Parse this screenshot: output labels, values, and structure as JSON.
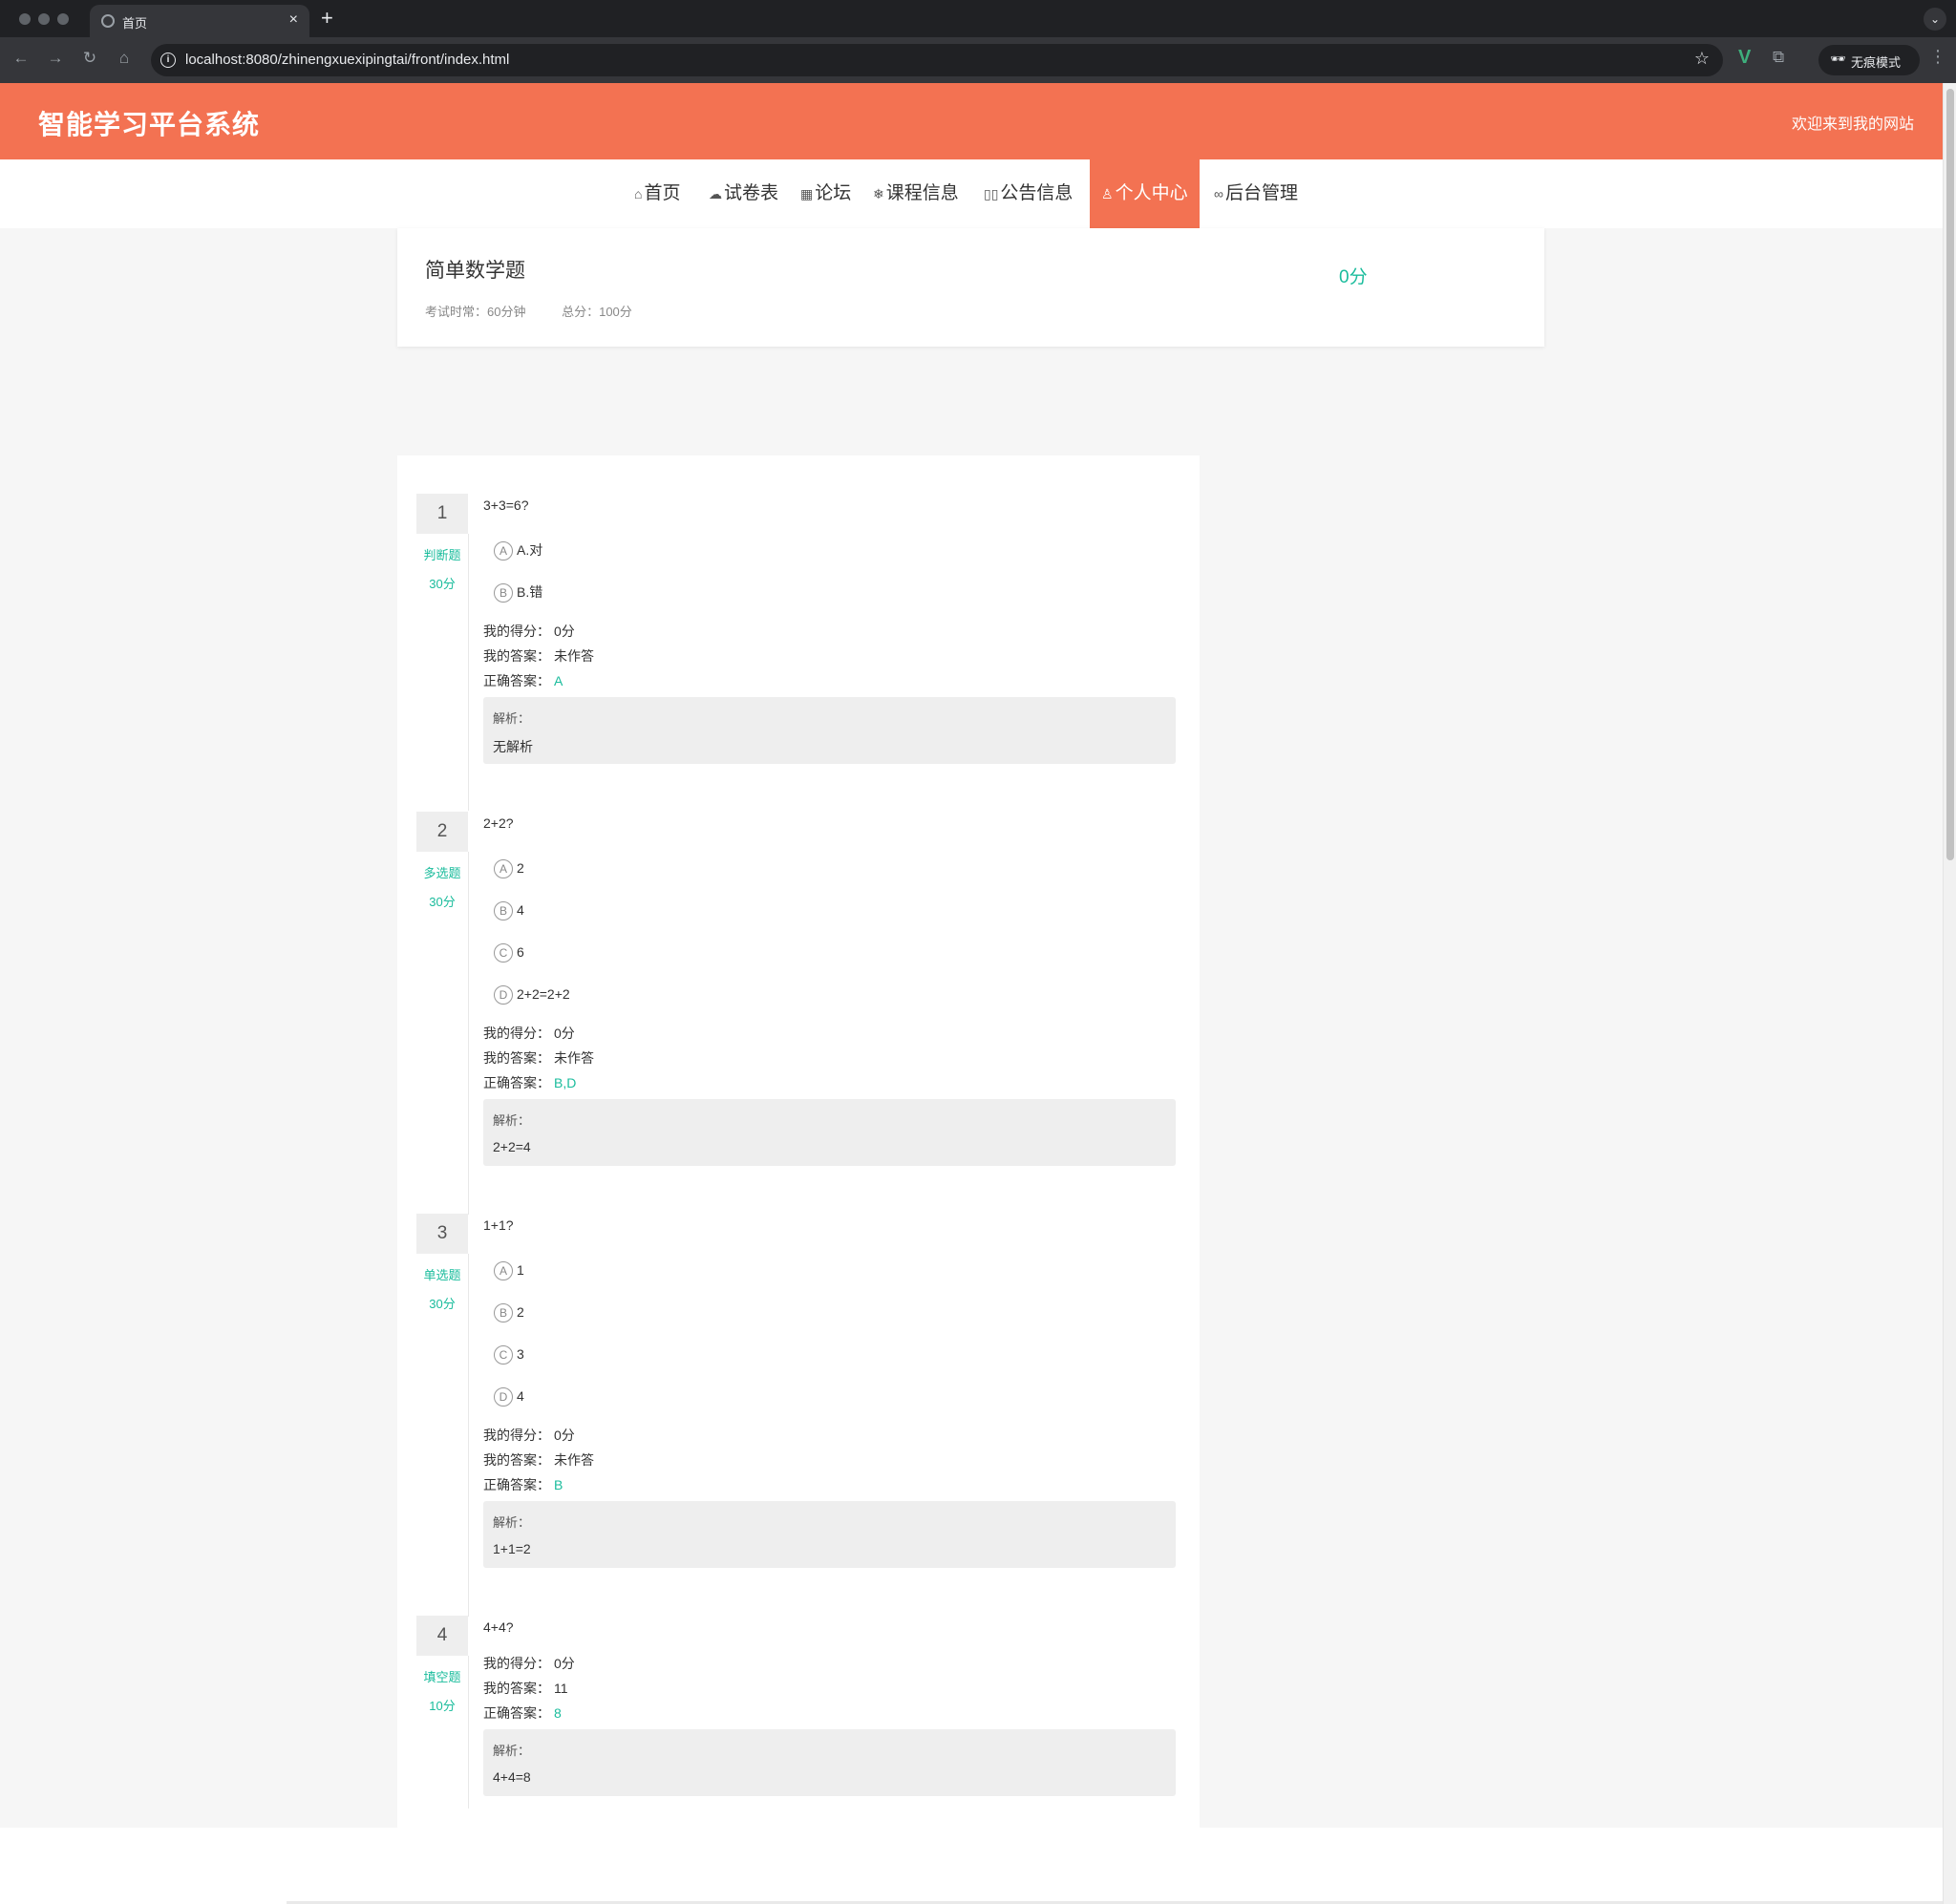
{
  "browser": {
    "tab_title": "首页",
    "tab_close": "×",
    "new_tab": "+",
    "url": "localhost:8080/zhinengxuexipingtai/front/index.html",
    "incognito_label": "无痕模式",
    "icons": [
      "back-icon",
      "forward-icon",
      "reload-icon",
      "home-icon",
      "info-icon",
      "star-icon",
      "vue-devtools-icon",
      "extensions-icon",
      "incognito-icon",
      "menu-icon"
    ]
  },
  "header": {
    "title": "智能学习平台系统",
    "welcome": "欢迎来到我的网站"
  },
  "nav": [
    {
      "label": "首页"
    },
    {
      "label": "试卷表"
    },
    {
      "label": "论坛"
    },
    {
      "label": "课程信息"
    },
    {
      "label": "公告信息"
    },
    {
      "label": "个人中心",
      "active": true
    },
    {
      "label": "后台管理"
    }
  ],
  "exam": {
    "title": "简单数学题",
    "duration": "考试时常：60分钟",
    "total": "总分：100分",
    "score": "0分"
  },
  "labels": {
    "my_score": "我的得分：",
    "my_answer": "我的答案：",
    "correct_answer": "正确答案：",
    "analysis": "解析："
  },
  "questions": [
    {
      "number": "1",
      "type": "判断题",
      "points": "30分",
      "text": "3+3=6?",
      "options": [
        {
          "letter": "A",
          "text": "A.对"
        },
        {
          "letter": "B",
          "text": "B.错"
        }
      ],
      "my_score": "0分",
      "my_answer": "未作答",
      "correct_answer": "A",
      "analysis": "无解析"
    },
    {
      "number": "2",
      "type": "多选题",
      "points": "30分",
      "text": "2+2?",
      "options": [
        {
          "letter": "A",
          "text": "2"
        },
        {
          "letter": "B",
          "text": "4"
        },
        {
          "letter": "C",
          "text": "6"
        },
        {
          "letter": "D",
          "text": "2+2=2+2"
        }
      ],
      "my_score": "0分",
      "my_answer": "未作答",
      "correct_answer": "B,D",
      "analysis": "2+2=4"
    },
    {
      "number": "3",
      "type": "单选题",
      "points": "30分",
      "text": "1+1?",
      "options": [
        {
          "letter": "A",
          "text": "1"
        },
        {
          "letter": "B",
          "text": "2"
        },
        {
          "letter": "C",
          "text": "3"
        },
        {
          "letter": "D",
          "text": "4"
        }
      ],
      "my_score": "0分",
      "my_answer": "未作答",
      "correct_answer": "B",
      "analysis": "1+1=2"
    },
    {
      "number": "4",
      "type": "填空题",
      "points": "10分",
      "text": "4+4?",
      "options": [],
      "my_score": "0分",
      "my_answer": "11",
      "correct_answer": "8",
      "analysis": "4+4=8"
    }
  ]
}
